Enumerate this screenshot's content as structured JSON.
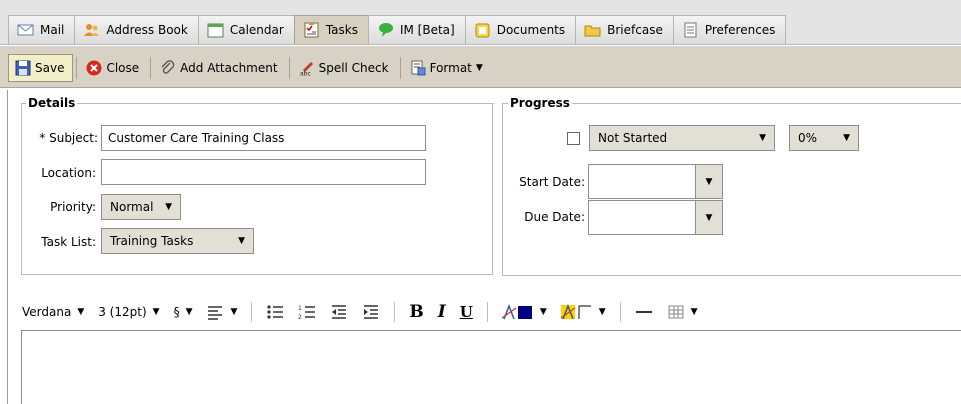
{
  "tabs": [
    {
      "label": "Mail",
      "icon": "envelope-icon"
    },
    {
      "label": "Address Book",
      "icon": "contacts-icon"
    },
    {
      "label": "Calendar",
      "icon": "calendar-icon"
    },
    {
      "label": "Tasks",
      "icon": "tasks-icon",
      "active": true
    },
    {
      "label": "IM [Beta]",
      "icon": "chat-bubble-icon"
    },
    {
      "label": "Documents",
      "icon": "documents-icon"
    },
    {
      "label": "Briefcase",
      "icon": "folder-icon"
    },
    {
      "label": "Preferences",
      "icon": "preferences-icon"
    }
  ],
  "toolbar": {
    "save_label": "Save",
    "close_label": "Close",
    "attach_label": "Add Attachment",
    "spell_label": "Spell Check",
    "format_label": "Format"
  },
  "details": {
    "legend": "Details",
    "subject_label": "* Subject:",
    "subject_value": "Customer Care Training Class",
    "location_label": "Location:",
    "location_value": "",
    "priority_label": "Priority:",
    "priority_value": "Normal",
    "tasklist_label": "Task List:",
    "tasklist_value": "Training Tasks"
  },
  "progress": {
    "legend": "Progress",
    "status_value": "Not Started",
    "percent_value": "0%",
    "start_label": "Start Date:",
    "start_value": "",
    "due_label": "Due Date:",
    "due_value": ""
  },
  "editor_toolbar": {
    "font_value": "Verdana",
    "size_value": "3 (12pt)",
    "style_symbol": "§"
  },
  "colors": {
    "accent_active_tab": "#d6d0c0",
    "toolbar_bg": "#d7d2c5",
    "save_bg": "#f2efc8",
    "text_color": "#00007f",
    "highlight": "#ffd400"
  }
}
